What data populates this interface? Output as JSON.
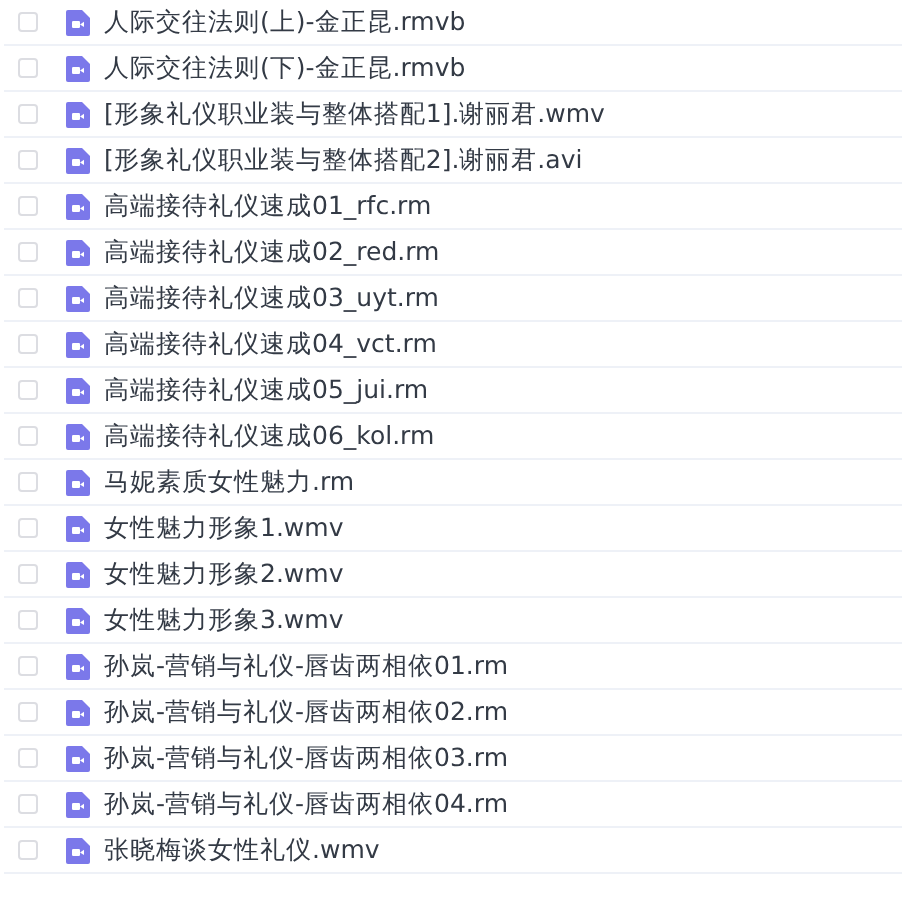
{
  "files": [
    {
      "name": "人际交往法则(上)-金正昆.rmvb",
      "checked": false
    },
    {
      "name": "人际交往法则(下)-金正昆.rmvb",
      "checked": false
    },
    {
      "name": "[形象礼仪职业装与整体搭配1].谢丽君.wmv",
      "checked": false
    },
    {
      "name": "[形象礼仪职业装与整体搭配2].谢丽君.avi",
      "checked": false
    },
    {
      "name": "高端接待礼仪速成01_rfc.rm",
      "checked": false
    },
    {
      "name": "高端接待礼仪速成02_red.rm",
      "checked": false
    },
    {
      "name": "高端接待礼仪速成03_uyt.rm",
      "checked": false
    },
    {
      "name": "高端接待礼仪速成04_vct.rm",
      "checked": false
    },
    {
      "name": "高端接待礼仪速成05_jui.rm",
      "checked": false
    },
    {
      "name": "高端接待礼仪速成06_kol.rm",
      "checked": false
    },
    {
      "name": "马妮素质女性魅力.rm",
      "checked": false
    },
    {
      "name": "女性魅力形象1.wmv",
      "checked": false
    },
    {
      "name": "女性魅力形象2.wmv",
      "checked": false
    },
    {
      "name": "女性魅力形象3.wmv",
      "checked": false
    },
    {
      "name": "孙岚-营销与礼仪-唇齿两相依01.rm",
      "checked": false
    },
    {
      "name": "孙岚-营销与礼仪-唇齿两相依02.rm",
      "checked": false
    },
    {
      "name": "孙岚-营销与礼仪-唇齿两相依03.rm",
      "checked": false
    },
    {
      "name": "孙岚-营销与礼仪-唇齿两相依04.rm",
      "checked": false
    },
    {
      "name": "张晓梅谈女性礼仪.wmv",
      "checked": false
    }
  ]
}
